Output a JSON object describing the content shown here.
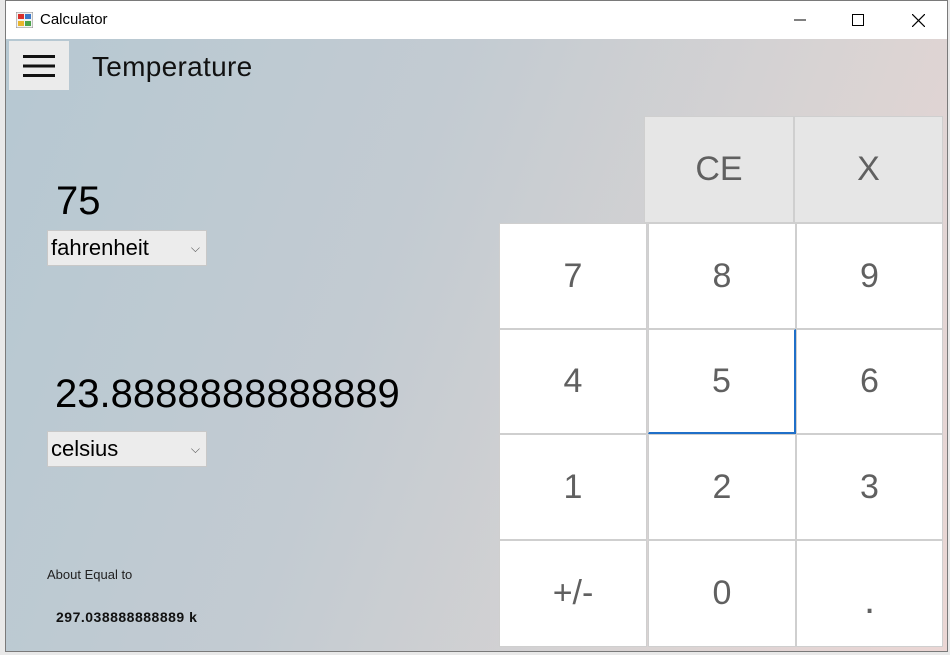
{
  "window": {
    "title": "Calculator",
    "icon": "calculator-app-icon"
  },
  "header": {
    "menu_icon": "hamburger-menu-icon",
    "mode_title": "Temperature"
  },
  "converter": {
    "input_value": "75",
    "input_unit": "fahrenheit",
    "output_value": "23.8888888888889",
    "output_unit": "celsius",
    "about_label": "About Equal to",
    "about_value": "297.038888888889 k"
  },
  "keypad": {
    "ce": "CE",
    "backspace": "X",
    "rows": [
      [
        "7",
        "8",
        "9"
      ],
      [
        "4",
        "5",
        "6"
      ],
      [
        "1",
        "2",
        "3"
      ],
      [
        "+/-",
        "0",
        "."
      ]
    ],
    "focused_key": "5"
  },
  "colors": {
    "focus_accent": "#1f6fc8",
    "key_background": "#ffffff",
    "function_key_background": "#e6e6e6"
  }
}
